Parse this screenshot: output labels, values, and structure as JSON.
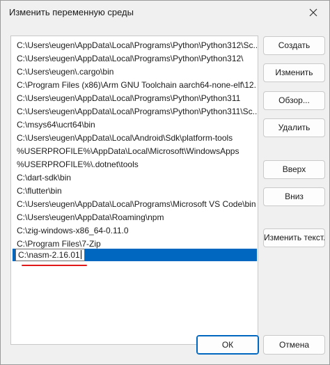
{
  "window": {
    "title": "Изменить переменную среды"
  },
  "list": {
    "items": [
      "C:\\Users\\eugen\\AppData\\Local\\Programs\\Python\\Python312\\Sc...",
      "C:\\Users\\eugen\\AppData\\Local\\Programs\\Python\\Python312\\",
      "C:\\Users\\eugen\\.cargo\\bin",
      "C:\\Program Files (x86)\\Arm GNU Toolchain aarch64-none-elf\\12....",
      "C:\\Users\\eugen\\AppData\\Local\\Programs\\Python\\Python311",
      "C:\\Users\\eugen\\AppData\\Local\\Programs\\Python\\Python311\\Sc...",
      "C:\\msys64\\ucrt64\\bin",
      "C:\\Users\\eugen\\AppData\\Local\\Android\\Sdk\\platform-tools",
      "%USERPROFILE%\\AppData\\Local\\Microsoft\\WindowsApps",
      "%USERPROFILE%\\.dotnet\\tools",
      "C:\\dart-sdk\\bin",
      "C:\\flutter\\bin",
      "C:\\Users\\eugen\\AppData\\Local\\Programs\\Microsoft VS Code\\bin",
      "C:\\Users\\eugen\\AppData\\Roaming\\npm",
      "C:\\zig-windows-x86_64-0.11.0",
      "C:\\Program Files\\7-Zip"
    ],
    "editing_value": "C:\\nasm-2.16.01"
  },
  "buttons": {
    "create": "Создать",
    "edit": "Изменить",
    "browse": "Обзор...",
    "delete": "Удалить",
    "up": "Вверх",
    "down": "Вниз",
    "edit_text": "Изменить текст...",
    "ok": "ОК",
    "cancel": "Отмена"
  },
  "colors": {
    "selection": "#0067c0",
    "annotation": "#e01818"
  }
}
